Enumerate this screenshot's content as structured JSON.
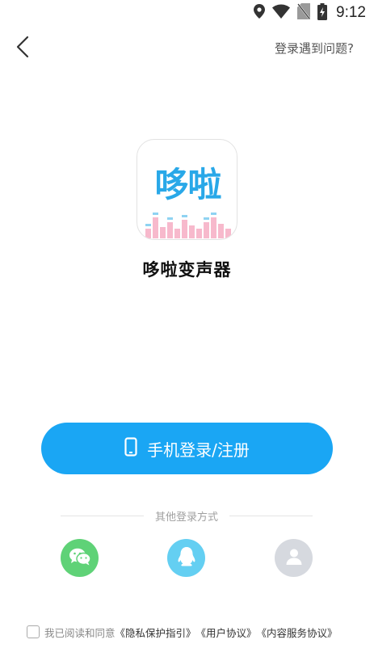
{
  "status_bar": {
    "time": "9:12",
    "icons": [
      "location-icon",
      "wifi-icon",
      "no-sim-icon",
      "battery-charging-icon"
    ]
  },
  "header": {
    "back_icon": "chevron-left-icon",
    "help_link": "登录遇到问题?"
  },
  "app": {
    "logo_text": "哆啦",
    "name": "哆啦变声器"
  },
  "login": {
    "phone_icon": "phone-icon",
    "phone_button_label": "手机登录/注册",
    "other_methods_label": "其他登录方式",
    "methods": [
      {
        "icon": "wechat-icon",
        "color": "#5fd277"
      },
      {
        "icon": "qq-icon",
        "color": "#64cff2"
      },
      {
        "icon": "user-icon",
        "color": "#d6d9df"
      }
    ]
  },
  "agreement": {
    "prefix": "我已阅读和同意",
    "privacy_guide": "《隐私保护指引》",
    "user_agreement": "《用户协议》",
    "content_service_agreement": "《内容服务协议》"
  },
  "colors": {
    "primary": "#1aa6f4",
    "logo_blue": "#29a8e8",
    "logo_pink": "#f7b9cc"
  }
}
